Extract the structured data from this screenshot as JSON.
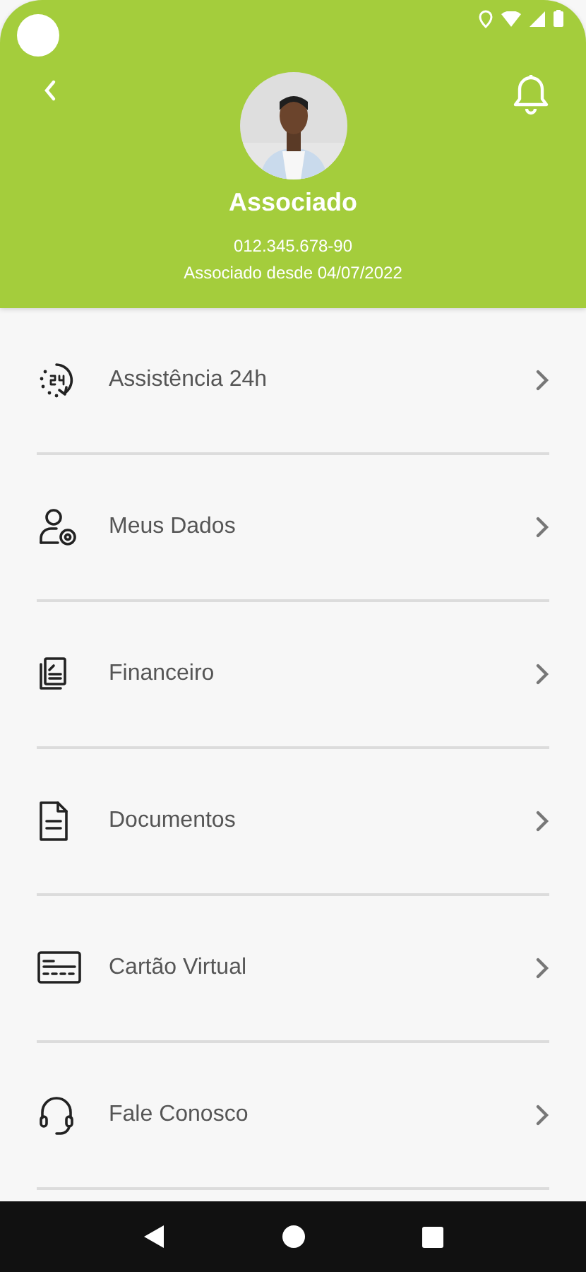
{
  "profile": {
    "name": "Associado",
    "document": "012.345.678-90",
    "member_since": "Associado desde 04/07/2022"
  },
  "menu": [
    {
      "kind": "clock",
      "label": "Assistência 24h"
    },
    {
      "kind": "user",
      "label": "Meus Dados"
    },
    {
      "kind": "receipt",
      "label": "Financeiro"
    },
    {
      "kind": "document",
      "label": "Documentos"
    },
    {
      "kind": "card",
      "label": "Cartão Virtual"
    },
    {
      "kind": "headset",
      "label": "Fale Conosco"
    }
  ]
}
